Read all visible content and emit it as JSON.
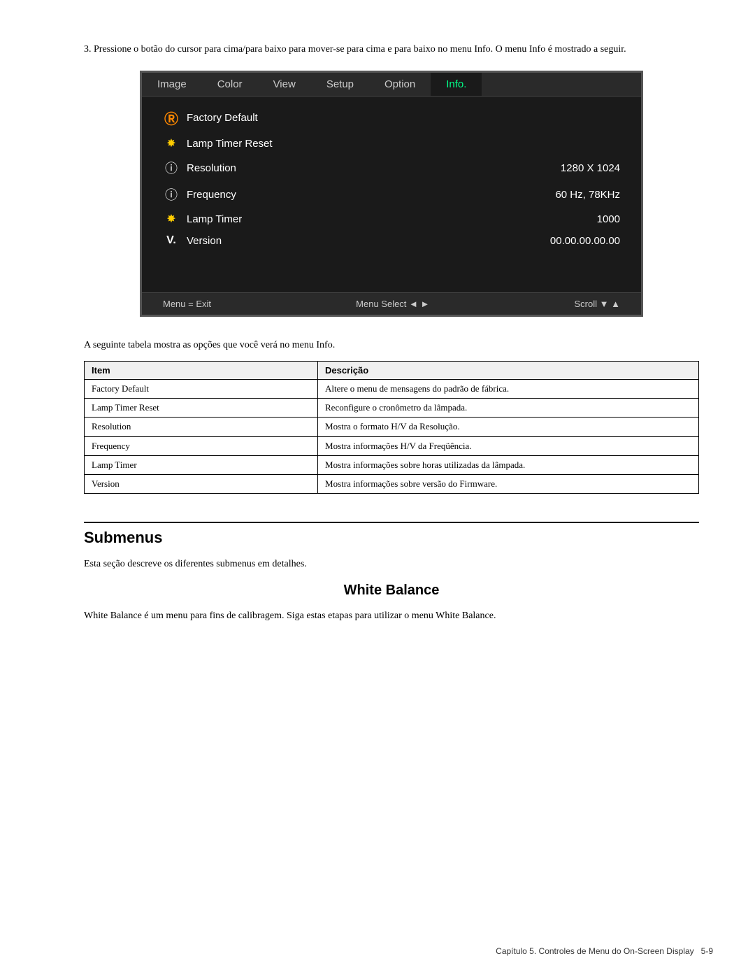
{
  "intro": {
    "text": "3.  Pressione o botão do cursor para cima/para baixo para mover-se para cima e para baixo no menu Info. O menu Info é mostrado a seguir."
  },
  "monitor": {
    "tabs": [
      {
        "label": "Image",
        "active": false
      },
      {
        "label": "Color",
        "active": false
      },
      {
        "label": "View",
        "active": false
      },
      {
        "label": "Setup",
        "active": false
      },
      {
        "label": "Option",
        "active": false
      },
      {
        "label": "Info.",
        "active": true
      }
    ],
    "rows": [
      {
        "icon": "Ⓡ",
        "icon_type": "reset",
        "label": "Factory Default",
        "value": ""
      },
      {
        "icon": "✿",
        "icon_type": "sun",
        "label": "Lamp Timer Reset",
        "value": ""
      },
      {
        "icon": "ℹ",
        "icon_type": "info-circle",
        "label": "Resolution",
        "value": "1280 X 1024"
      },
      {
        "icon": "ℹ",
        "icon_type": "info-circle",
        "label": "Frequency",
        "value": "60 Hz, 78KHz"
      },
      {
        "icon": "✿",
        "icon_type": "sun",
        "label": "Lamp Timer",
        "value": "1000"
      },
      {
        "icon": "V.",
        "icon_type": "version",
        "label": "Version",
        "value": "00.00.00.00.00"
      }
    ],
    "footer": [
      {
        "label": "Menu = Exit"
      },
      {
        "label": "Menu Select ◄ ►"
      },
      {
        "label": "Scroll ▼ ▲"
      }
    ]
  },
  "table_intro": "A seguinte tabela mostra as opções que você verá no menu Info.",
  "table": {
    "headers": [
      "Item",
      "Descrição"
    ],
    "rows": [
      {
        "item": "Factory Default",
        "desc": "Altere o menu de mensagens do padrão de fábrica."
      },
      {
        "item": "Lamp Timer Reset",
        "desc": "Reconfigure o cronômetro da lâmpada."
      },
      {
        "item": "Resolution",
        "desc": "Mostra o formato H/V da Resolução."
      },
      {
        "item": "Frequency",
        "desc": "Mostra informações H/V da Freqüência."
      },
      {
        "item": "Lamp Timer",
        "desc": "Mostra informações sobre horas utilizadas da lâmpada."
      },
      {
        "item": "Version",
        "desc": "Mostra informações sobre versão do Firmware."
      }
    ]
  },
  "submenus": {
    "section_title": "Submenus",
    "section_intro": "Esta seção descreve os diferentes submenus em detalhes.",
    "white_balance": {
      "title": "White Balance",
      "text": "White Balance é um menu para fins de calibragem. Siga estas etapas para utilizar o menu White Balance."
    }
  },
  "footer": {
    "text": "Capítulo 5. Controles de Menu do On-Screen Display",
    "page": "5-9"
  }
}
